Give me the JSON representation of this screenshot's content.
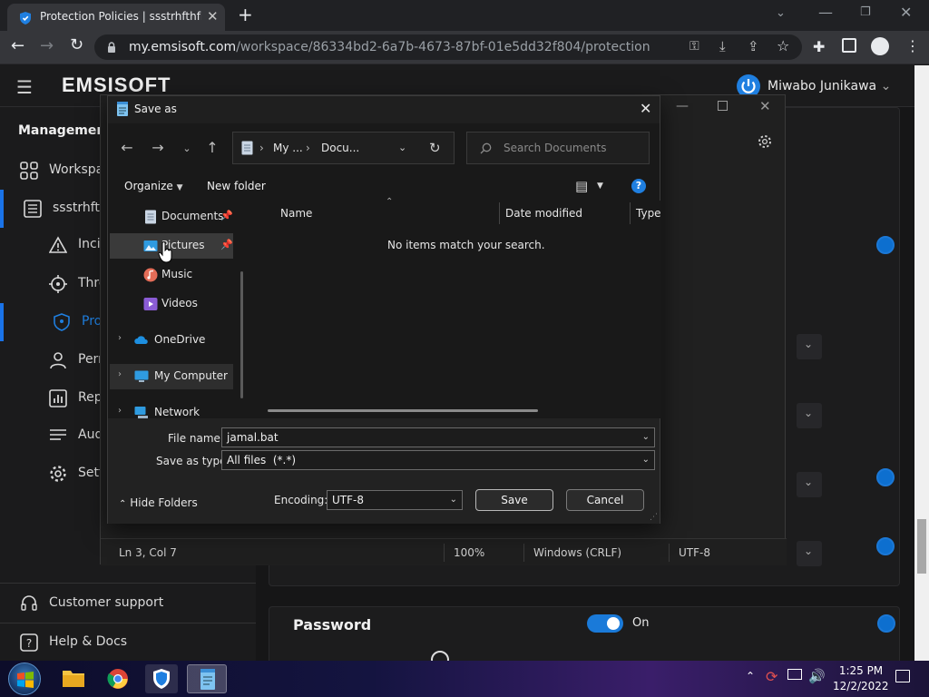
{
  "browser": {
    "tab_title": "Protection Policies | ssstrhfthfh | E",
    "url_host": "my.emsisoft.com",
    "url_path": "/workspace/86334bd2-6a7b-4673-87bf-01e5dd32f804/protection"
  },
  "app": {
    "brand": "EMSISOFT",
    "user_name": "Miwabo Junikawa",
    "sidebar": {
      "section_title": "Management",
      "items": [
        {
          "label": "Workspa",
          "icon": "grid-icon"
        },
        {
          "label": "ssstrhfthf",
          "icon": "list-icon"
        },
        {
          "label": "Incid",
          "icon": "warning-icon"
        },
        {
          "label": "Thre",
          "icon": "crosshair-icon"
        },
        {
          "label": "Pro",
          "icon": "shield-icon"
        },
        {
          "label": "Perm",
          "icon": "person-icon"
        },
        {
          "label": "Repo",
          "icon": "report-icon"
        },
        {
          "label": "Aud",
          "icon": "lines-icon"
        },
        {
          "label": "Setti",
          "icon": "gear-icon"
        }
      ],
      "footer": [
        {
          "label": "Customer support",
          "icon": "headset-icon"
        },
        {
          "label": "Help & Docs",
          "icon": "help-icon"
        }
      ]
    },
    "password_section": {
      "title": "Password",
      "toggle_state": "On"
    }
  },
  "notepad_status": {
    "position": "Ln 3, Col 7",
    "zoom": "100%",
    "line_endings": "Windows (CRLF)",
    "encoding": "UTF-8"
  },
  "save_dialog": {
    "title": "Save as",
    "breadcrumb": [
      "My ...",
      "Docu..."
    ],
    "search_placeholder": "Search Documents",
    "organize_label": "Organize",
    "new_folder_label": "New folder",
    "tree": [
      {
        "label": "Documents",
        "pinned": true
      },
      {
        "label": "Pictures",
        "pinned": true
      },
      {
        "label": "Music",
        "pinned": false
      },
      {
        "label": "Videos",
        "pinned": false
      },
      {
        "label": "OneDrive",
        "pinned": false
      },
      {
        "label": "My Computer",
        "pinned": false
      },
      {
        "label": "Network",
        "pinned": false
      }
    ],
    "columns": [
      "Name",
      "Date modified",
      "Type"
    ],
    "empty_message": "No items match your search.",
    "file_name_label": "File name:",
    "file_name_value": "jamal.bat",
    "save_type_label": "Save as type:",
    "save_type_value": "All files  (*.*)",
    "hide_folders_label": "Hide Folders",
    "encoding_label": "Encoding:",
    "encoding_value": "UTF-8",
    "save_button": "Save",
    "cancel_button": "Cancel"
  },
  "taskbar": {
    "time": "1:25 PM",
    "date": "12/2/2022"
  },
  "colors": {
    "accent": "#1a73e8",
    "toggle_on": "#1a7ad9"
  }
}
